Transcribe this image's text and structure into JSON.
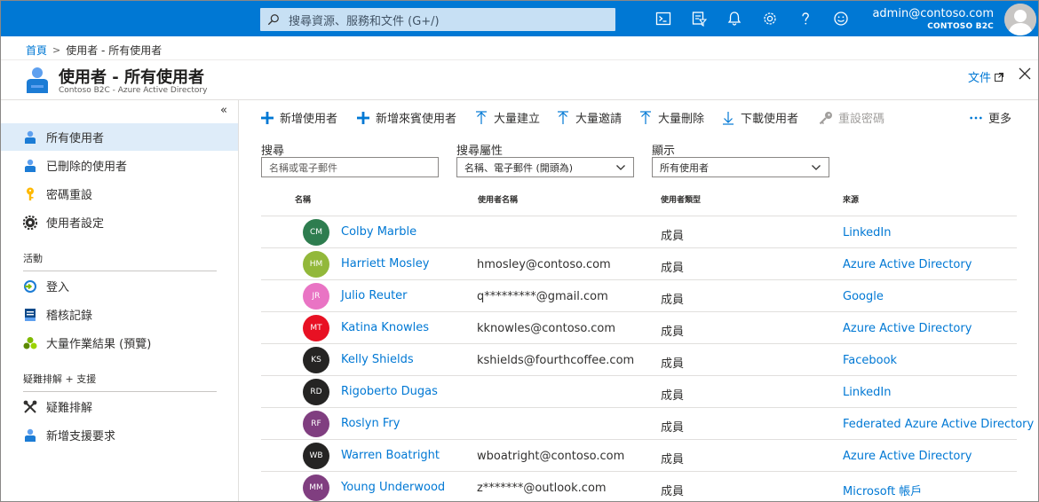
{
  "topbar": {
    "search_placeholder": "搜尋資源、服務和文件 (G+/)",
    "account_email": "admin@contoso.com",
    "account_tenant": "CONTOSO B2C",
    "bg_color": "#0078d4",
    "icons": [
      "cloud-shell-icon",
      "directory-filter-icon",
      "notifications-icon",
      "settings-icon",
      "help-icon",
      "feedback-icon"
    ]
  },
  "breadcrumb": {
    "home": "首頁",
    "current": "使用者 - 所有使用者"
  },
  "header": {
    "title": "使用者 - 所有使用者",
    "subtitle": "Contoso B2C - Azure Active Directory",
    "docs_link": "文件"
  },
  "sidebar": {
    "items": [
      {
        "label": "所有使用者",
        "icon": "user-icon",
        "active": true
      },
      {
        "label": "已刪除的使用者",
        "icon": "deleted-user-icon"
      },
      {
        "label": "密碼重設",
        "icon": "key-icon"
      },
      {
        "label": "使用者設定",
        "icon": "gear-icon"
      }
    ],
    "activity_heading": "活動",
    "activity_items": [
      {
        "label": "登入",
        "icon": "sign-in-icon"
      },
      {
        "label": "稽核記錄",
        "icon": "audit-log-icon"
      },
      {
        "label": "大量作業結果 (預覽)",
        "icon": "bulk-results-icon"
      }
    ],
    "support_heading": "疑難排解 + 支援",
    "support_items": [
      {
        "label": "疑難排解",
        "icon": "troubleshoot-icon"
      },
      {
        "label": "新增支援要求",
        "icon": "support-request-icon"
      }
    ]
  },
  "toolbar": {
    "new_user": "新增使用者",
    "new_guest": "新增來賓使用者",
    "bulk_create": "大量建立",
    "bulk_invite": "大量邀請",
    "bulk_delete": "大量刪除",
    "download": "下載使用者",
    "reset_password": "重設密碼",
    "more": "更多"
  },
  "filters": {
    "search_label": "搜尋",
    "search_placeholder": "名稱或電子郵件",
    "attr_label": "搜尋屬性",
    "attr_value": "名稱、電子郵件 (開頭為)",
    "show_label": "顯示",
    "show_value": "所有使用者"
  },
  "table": {
    "headers": [
      "名稱",
      "使用者名稱",
      "使用者類型",
      "來源"
    ],
    "rows": [
      {
        "initials": "CM",
        "color": "#2e7d4f",
        "name": "Colby Marble",
        "username": "",
        "type": "成員",
        "source": "LinkedIn"
      },
      {
        "initials": "HM",
        "color": "#92b83a",
        "name": "Harriett Mosley",
        "username": "hmosley@contoso.com",
        "type": "成員",
        "source": "Azure Active Directory"
      },
      {
        "initials": "JR",
        "color": "#e974c4",
        "name": "Julio Reuter",
        "username": "q*********@gmail.com",
        "type": "成員",
        "source": "Google"
      },
      {
        "initials": "MT",
        "color": "#e81123",
        "name": "Katina Knowles",
        "username": "kknowles@contoso.com",
        "type": "成員",
        "source": "Azure Active Directory"
      },
      {
        "initials": "KS",
        "color": "#252423",
        "name": "Kelly Shields",
        "username": "kshields@fourthcoffee.com",
        "type": "成員",
        "source": "Facebook"
      },
      {
        "initials": "RD",
        "color": "#252423",
        "name": "Rigoberto Dugas",
        "username": "",
        "type": "成員",
        "source": "LinkedIn"
      },
      {
        "initials": "RF",
        "color": "#803e80",
        "name": "Roslyn Fry",
        "username": "",
        "type": "成員",
        "source": "Federated Azure Active Directory"
      },
      {
        "initials": "WB",
        "color": "#252423",
        "name": "Warren Boatright",
        "username": "wboatright@contoso.com",
        "type": "成員",
        "source": "Azure Active Directory"
      },
      {
        "initials": "MM",
        "color": "#803e80",
        "name": "Young Underwood",
        "username": "z*******@outlook.com",
        "type": "成員",
        "source": "Microsoft 帳戶"
      }
    ]
  }
}
